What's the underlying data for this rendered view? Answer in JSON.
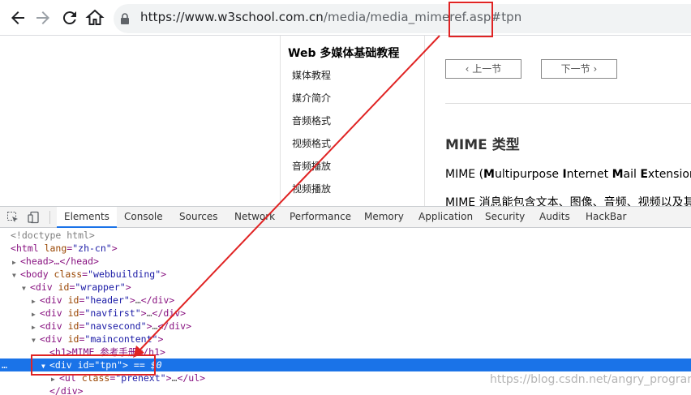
{
  "browser": {
    "url_host": "https://www.w3school.com.cn",
    "url_path": "/media/media_mimeref.asp",
    "url_hash": "#tpn"
  },
  "page": {
    "side_title": "Web 多媒体基础教程",
    "side_items": [
      "媒体教程",
      "媒介简介",
      "音频格式",
      "视频格式",
      "音频播放",
      "视频播放"
    ],
    "prev_label": "上一节",
    "next_label": "下一节",
    "heading": "MIME 类型",
    "para1_parts": [
      "MIME (",
      "M",
      "ultipurpose ",
      "I",
      "nternet ",
      "M",
      "ail ",
      "E",
      "xtensions) 是"
    ],
    "para2": "MIME 消息能包含文本、图像、音频、视频以及其"
  },
  "devtools": {
    "tabs": [
      "Elements",
      "Console",
      "Sources",
      "Network",
      "Performance",
      "Memory",
      "Application",
      "Security",
      "Audits",
      "HackBar"
    ],
    "active_tab": "Elements",
    "tree": {
      "doctype": "<!doctype html>",
      "html_open": "html",
      "html_attr": "lang",
      "html_val": "\"zh-cn\"",
      "head": "<head>…</head>",
      "body_attr": "class",
      "body_val": "\"webbuilding\"",
      "wrapper_val": "\"wrapper\"",
      "header_val": "\"header\"",
      "navfirst_val": "\"navfirst\"",
      "navsecond_val": "\"navsecond\"",
      "maincontent_val": "\"maincontent\"",
      "h1_text": "<h1>MIME 参考手册</h1>",
      "tpn_val": "\"tpn\"",
      "tpn_eq": "== $0",
      "ul_attr": "class",
      "ul_val": "\"prenext\"",
      "div_close": "</div>"
    }
  },
  "watermark": "https://blog.csdn.net/angry_program",
  "colors": {
    "annotation": "#e02323",
    "selection": "#1a73e8"
  }
}
